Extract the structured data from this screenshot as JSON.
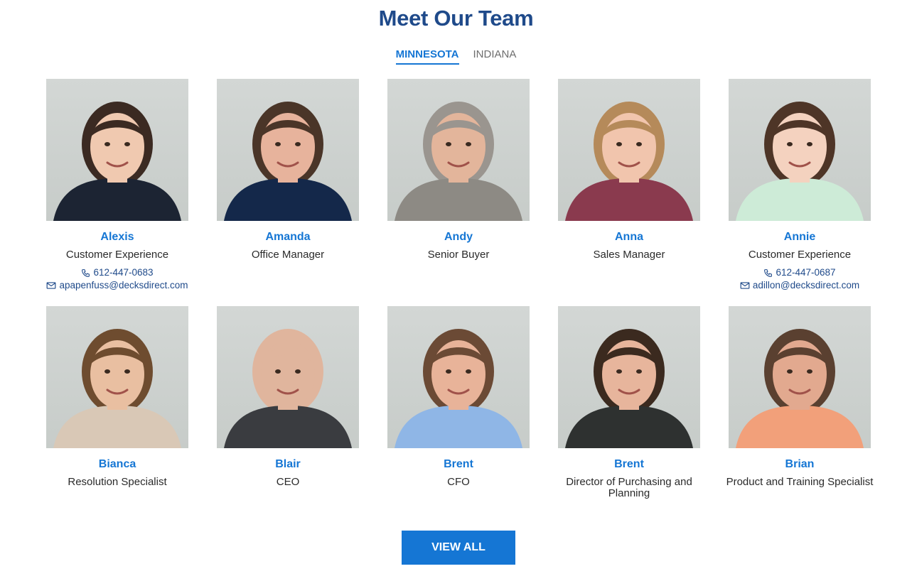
{
  "page": {
    "title": "Meet Our Team"
  },
  "tabs": [
    {
      "label": "MINNESOTA",
      "active": true
    },
    {
      "label": "INDIANA",
      "active": false
    }
  ],
  "team": [
    {
      "name": "Alexis",
      "role": "Customer Experience",
      "phone": "612-447-0683",
      "email": "apapenfuss@decksdirect.com",
      "photo": {
        "hair": "#3b2a22",
        "skin": "#f0c9b0",
        "shirt": "#1c2433"
      }
    },
    {
      "name": "Amanda",
      "role": "Office Manager",
      "photo": {
        "hair": "#4a3528",
        "skin": "#e7b39c",
        "shirt": "#14284a"
      }
    },
    {
      "name": "Andy",
      "role": "Senior Buyer",
      "photo": {
        "hair": "#9a958f",
        "skin": "#e3b59b",
        "shirt": "#8d8a84"
      }
    },
    {
      "name": "Anna",
      "role": "Sales Manager",
      "photo": {
        "hair": "#b58a5a",
        "skin": "#f1c5ad",
        "shirt": "#8a3a4e"
      }
    },
    {
      "name": "Annie",
      "role": "Customer Experience",
      "phone": "612-447-0687",
      "email": "adillon@decksdirect.com",
      "photo": {
        "hair": "#4e3527",
        "skin": "#f4d2bf",
        "shirt": "#cdebd7"
      }
    },
    {
      "name": "Bianca",
      "role": "Resolution Specialist",
      "photo": {
        "hair": "#6e4c2f",
        "skin": "#e9bfa1",
        "shirt": "#d9c8b6"
      }
    },
    {
      "name": "Blair",
      "role": "CEO",
      "photo": {
        "hair": "#e0b59d",
        "skin": "#e0b59d",
        "shirt": "#3a3c40"
      }
    },
    {
      "name": "Brent",
      "role": "CFO",
      "photo": {
        "hair": "#6b4a35",
        "skin": "#e8b399",
        "shirt": "#8fb6e6"
      }
    },
    {
      "name": "Brent",
      "role": "Director of Purchasing and Planning",
      "photo": {
        "hair": "#3b2a1f",
        "skin": "#e7b59c",
        "shirt": "#2e3130"
      }
    },
    {
      "name": "Brian",
      "role": "Product and Training Specialist",
      "photo": {
        "hair": "#5a4030",
        "skin": "#e2a98f",
        "shirt": "#f2a07a"
      }
    }
  ],
  "cta": {
    "label": "VIEW ALL"
  },
  "colors": {
    "accent": "#1576d4",
    "title": "#1f4a8a"
  }
}
